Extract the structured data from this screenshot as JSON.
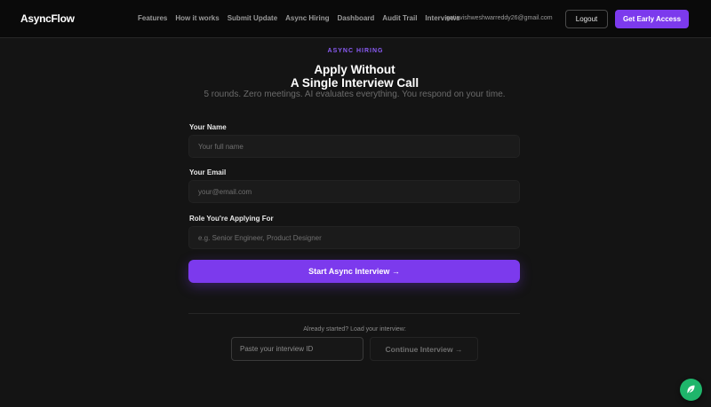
{
  "nav": {
    "logo": "AsyncFlow",
    "links": [
      "Features",
      "How it works",
      "Submit Update",
      "Async Hiring",
      "Dashboard",
      "Audit Trail",
      "Interviews"
    ],
    "email": "gatiavishweshwarreddy26@gmail.com",
    "logout_label": "Logout",
    "early_access_label": "Get Early Access"
  },
  "hero": {
    "eyebrow": "ASYNC HIRING",
    "title_line1": "Apply Without",
    "title_line2": "A Single Interview Call",
    "subtitle": "5 rounds. Zero meetings. AI evaluates everything. You respond on your time."
  },
  "form": {
    "name_label": "Your Name",
    "name_placeholder": "Your full name",
    "email_label": "Your Email",
    "email_placeholder": "your@email.com",
    "role_label": "Role You're Applying For",
    "role_placeholder": "e.g. Senior Engineer, Product Designer",
    "submit_label": "Start Async Interview →"
  },
  "resume": {
    "prompt": "Already started? Load your interview:",
    "id_placeholder": "Paste your interview ID",
    "continue_label": "Continue Interview →"
  },
  "colors": {
    "accent": "#7c3aed",
    "eyebrow": "#8b5cf6",
    "fab": "#1fb56b"
  },
  "icons": {
    "fab": "leaf-icon"
  }
}
